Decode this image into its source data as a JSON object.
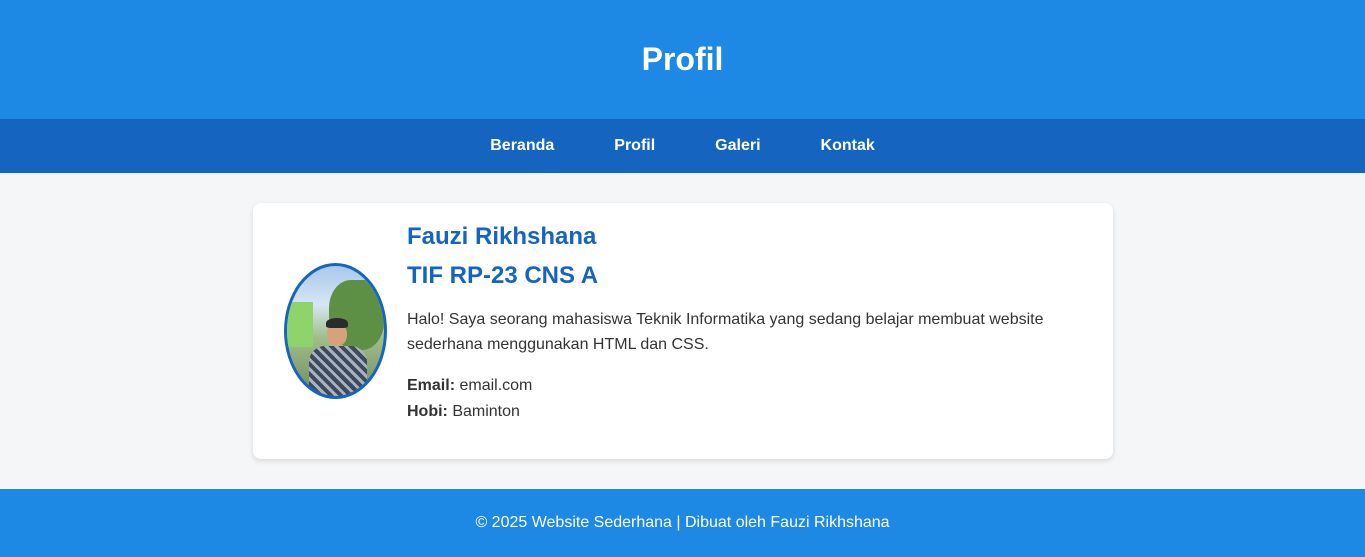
{
  "header": {
    "title": "Profil"
  },
  "nav": {
    "items": [
      "Beranda",
      "Profil",
      "Galeri",
      "Kontak"
    ]
  },
  "profile": {
    "name": "Fauzi Rikhshana",
    "class": "TIF RP-23 CNS A",
    "description": "Halo! Saya seorang mahasiswa Teknik Informatika yang sedang belajar membuat website sederhana menggunakan HTML dan CSS.",
    "email_label": "Email:",
    "email": "email.com",
    "hobby_label": "Hobi:",
    "hobby": "Baminton"
  },
  "footer": {
    "text": "© 2025 Website Sederhana | Dibuat oleh Fauzi Rikhshana"
  },
  "colors": {
    "primary": "#1e88e5",
    "nav": "#1565c0",
    "background": "#f4f6f8"
  }
}
